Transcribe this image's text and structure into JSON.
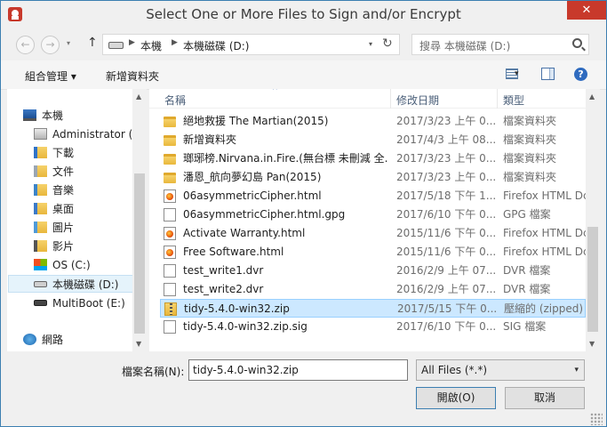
{
  "window": {
    "title": "Select One or More Files to Sign and/or Encrypt",
    "close_glyph": "✕",
    "accent_color": "#c8392b"
  },
  "navigation": {
    "back_glyph": "←",
    "forward_glyph": "→",
    "recent_glyph": "▾",
    "up_glyph": "↑",
    "crumbs": [
      "本機",
      "本機磁碟 (D:)"
    ],
    "crumb_sep": "▶",
    "dropdown_glyph": "▾",
    "refresh_glyph": "↻",
    "search_placeholder": "搜尋 本機磁碟 (D:)"
  },
  "toolbar": {
    "organize_label": "組合管理 ▾",
    "new_folder_label": "新增資料夾",
    "view_dropdown_glyph": "▾",
    "help_glyph": "?"
  },
  "nav_tree": [
    {
      "label": "本機",
      "icon": "computer-icon"
    },
    {
      "label": "Administrator (u",
      "icon": "user-folder-icon"
    },
    {
      "label": "下載",
      "icon": "downloads-icon"
    },
    {
      "label": "文件",
      "icon": "documents-icon"
    },
    {
      "label": "音樂",
      "icon": "music-icon"
    },
    {
      "label": "桌面",
      "icon": "desktop-icon"
    },
    {
      "label": "圖片",
      "icon": "pictures-icon"
    },
    {
      "label": "影片",
      "icon": "videos-icon"
    },
    {
      "label": "OS (C:)",
      "icon": "os-drive-icon"
    },
    {
      "label": "本機磁碟 (D:)",
      "icon": "drive-icon",
      "selected": true
    },
    {
      "label": "MultiBoot (E:)",
      "icon": "drive-icon"
    },
    {
      "label": "網路",
      "icon": "network-icon"
    }
  ],
  "columns": {
    "name": "名稱",
    "date": "修改日期",
    "type": "類型",
    "sort_glyph": "^"
  },
  "files": [
    {
      "name": "絕地救援 The Martian(2015)",
      "date": "2017/3/23 上午 0...",
      "type": "檔案資料夾",
      "icon": "folder-icon"
    },
    {
      "name": "新增資料夾",
      "date": "2017/4/3 上午 08...",
      "type": "檔案資料夾",
      "icon": "folder-icon"
    },
    {
      "name": "瑯琊榜.Nirvana.in.Fire.(無台標 未刪減 全...",
      "date": "2017/3/23 上午 0...",
      "type": "檔案資料夾",
      "icon": "folder-icon"
    },
    {
      "name": "潘恩_航向夢幻島 Pan(2015)",
      "date": "2017/3/23 上午 0...",
      "type": "檔案資料夾",
      "icon": "folder-icon"
    },
    {
      "name": "06asymmetricCipher.html",
      "date": "2017/5/18 下午 1...",
      "type": "Firefox HTML Dc",
      "icon": "firefox-html-icon"
    },
    {
      "name": "06asymmetricCipher.html.gpg",
      "date": "2017/6/10 下午 0...",
      "type": "GPG 檔案",
      "icon": "document-icon"
    },
    {
      "name": "Activate Warranty.html",
      "date": "2015/11/6 下午 0...",
      "type": "Firefox HTML Dc",
      "icon": "firefox-html-icon"
    },
    {
      "name": "Free Software.html",
      "date": "2015/11/6 下午 0...",
      "type": "Firefox HTML Dc",
      "icon": "firefox-html-icon"
    },
    {
      "name": "test_write1.dvr",
      "date": "2016/2/9 上午 07...",
      "type": "DVR 檔案",
      "icon": "document-icon"
    },
    {
      "name": "test_write2.dvr",
      "date": "2016/2/9 上午 07...",
      "type": "DVR 檔案",
      "icon": "document-icon"
    },
    {
      "name": "tidy-5.4.0-win32.zip",
      "date": "2017/5/15 下午 0...",
      "type": "壓縮的 (zipped) ...",
      "icon": "zip-icon",
      "selected": true
    },
    {
      "name": "tidy-5.4.0-win32.zip.sig",
      "date": "2017/6/10 下午 0...",
      "type": "SIG 檔案",
      "icon": "document-icon"
    }
  ],
  "footer": {
    "filename_label": "檔案名稱(N):",
    "filename_value": "tidy-5.4.0-win32.zip",
    "filter_value": "All Files (*.*)",
    "filter_drop_glyph": "▾",
    "open_label": "開啟(O)",
    "cancel_label": "取消"
  },
  "scroll_glyphs": {
    "up": "▲",
    "down": "▼"
  }
}
